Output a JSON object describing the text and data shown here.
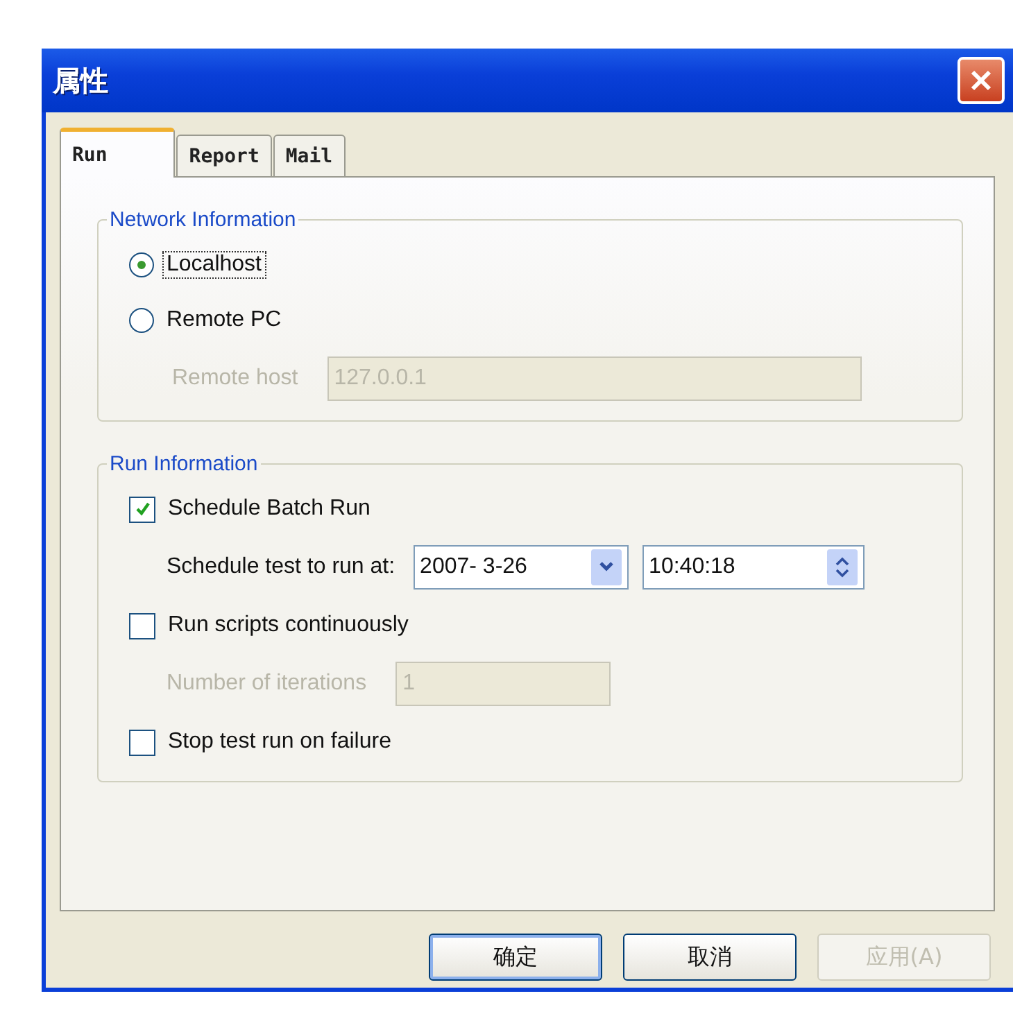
{
  "window": {
    "title": "属性"
  },
  "tabs": [
    {
      "label": "Run",
      "selected": true
    },
    {
      "label": "Report",
      "selected": false
    },
    {
      "label": "Mail",
      "selected": false
    }
  ],
  "network_information": {
    "title": "Network Information",
    "options": [
      {
        "label": "Localhost",
        "selected": true,
        "focused": true
      },
      {
        "label": "Remote PC",
        "selected": false,
        "focused": false
      }
    ],
    "remote_host": {
      "label": "Remote host",
      "value": "127.0.0.1",
      "disabled": true
    }
  },
  "run_information": {
    "title": "Run Information",
    "schedule_batch_run": {
      "label": "Schedule Batch Run",
      "checked": true
    },
    "schedule_time": {
      "label": "Schedule test to run at:",
      "date": "2007-  3-26",
      "time": "10:40:18"
    },
    "run_continuously": {
      "label": "Run scripts continuously",
      "checked": false
    },
    "iterations": {
      "label": "Number of iterations",
      "value": "1",
      "disabled": true
    },
    "stop_on_failure": {
      "label": "Stop test run on failure",
      "checked": false
    }
  },
  "buttons": [
    {
      "label": "确定",
      "disabled": false,
      "default": true
    },
    {
      "label": "取消",
      "disabled": false,
      "default": false
    },
    {
      "label": "应用(A)",
      "disabled": true,
      "default": false
    }
  ]
}
